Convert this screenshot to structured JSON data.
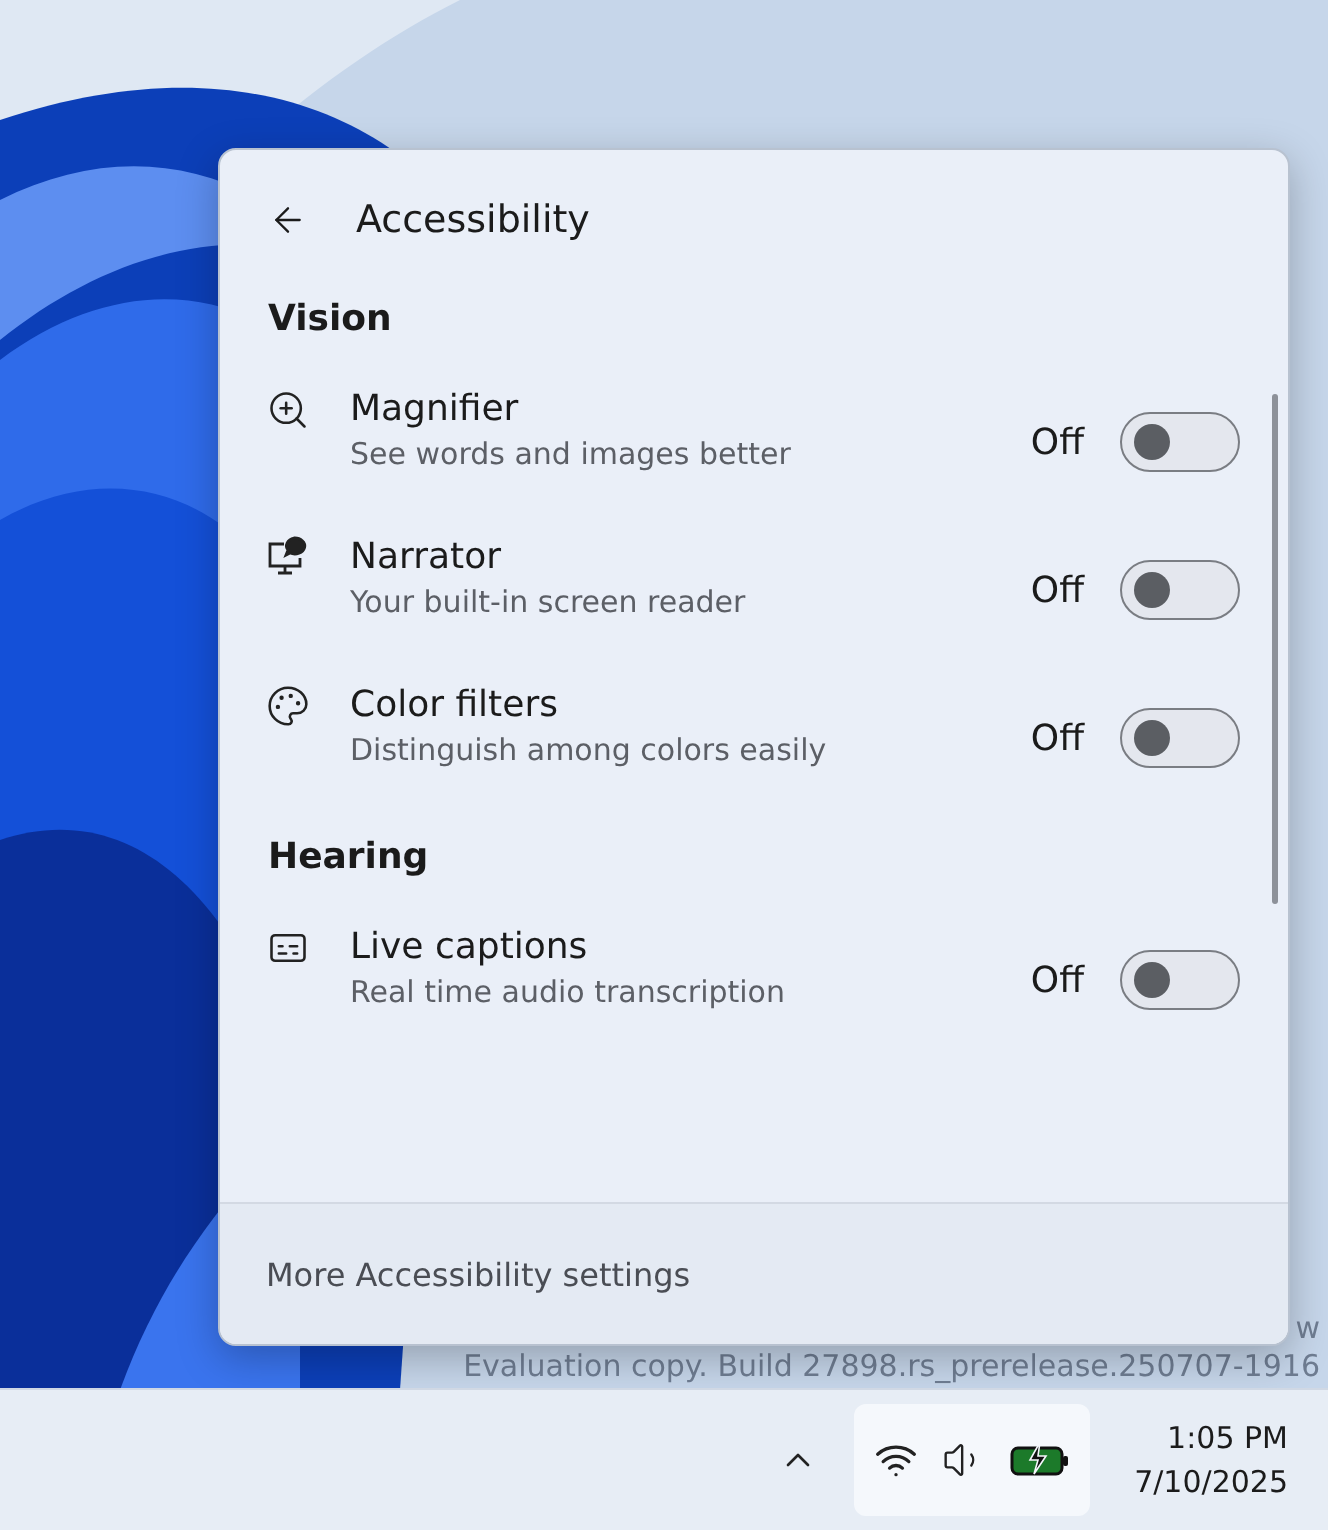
{
  "panel": {
    "title": "Accessibility",
    "sections": [
      {
        "title": "Vision",
        "items": [
          {
            "kind": "magnifier",
            "name": "Magnifier",
            "description": "See words and images better",
            "state_label": "Off",
            "on": false
          },
          {
            "kind": "narrator",
            "name": "Narrator",
            "description": "Your built-in screen reader",
            "state_label": "Off",
            "on": false
          },
          {
            "kind": "palette",
            "name": "Color filters",
            "description": "Distinguish among colors easily",
            "state_label": "Off",
            "on": false
          }
        ]
      },
      {
        "title": "Hearing",
        "items": [
          {
            "kind": "captions",
            "name": "Live captions",
            "description": "Real time audio transcription",
            "state_label": "Off",
            "on": false
          }
        ]
      }
    ],
    "footer_link": "More Accessibility settings"
  },
  "desktop_watermark": [
    "w",
    "Evaluation copy. Build 27898.rs_prerelease.250707-1916"
  ],
  "taskbar": {
    "time": "1:05 PM",
    "date": "7/10/2025"
  }
}
